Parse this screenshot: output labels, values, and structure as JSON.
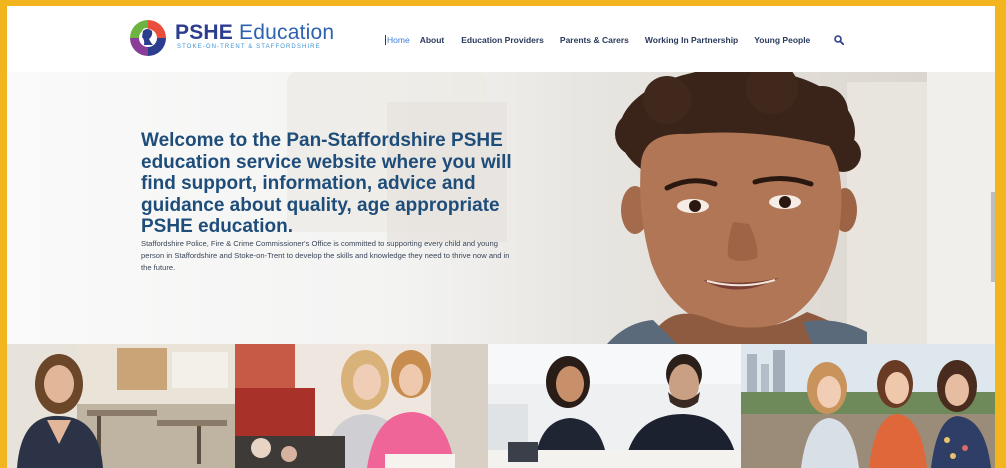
{
  "header": {
    "logo": {
      "title_bold": "PSHE",
      "title_rest": "Education",
      "subtitle": "STOKE-ON-TRENT & STAFFORDSHIRE"
    },
    "nav": [
      {
        "label": "Home",
        "active": true
      },
      {
        "label": "About"
      },
      {
        "label": "Education Providers"
      },
      {
        "label": "Parents & Carers"
      },
      {
        "label": "Working In Partnership"
      },
      {
        "label": "Young People"
      }
    ],
    "search_icon": "search-icon"
  },
  "hero": {
    "heading": "Welcome to the Pan-Staffordshire PSHE education service website where you will find support, information, advice and guidance about quality, age appropriate PSHE education.",
    "body": "Staffordshire Police, Fire & Crime Commissioner's Office is committed to supporting every child and young person in Staffordshire and Stoke-on-Trent to develop the skills and knowledge they need to thrive now and in the future."
  },
  "colors": {
    "frame": "#f2b51e",
    "heading": "#1f4d7a",
    "brand": "#2c3d8f",
    "nav_active": "#3c7fd6"
  }
}
